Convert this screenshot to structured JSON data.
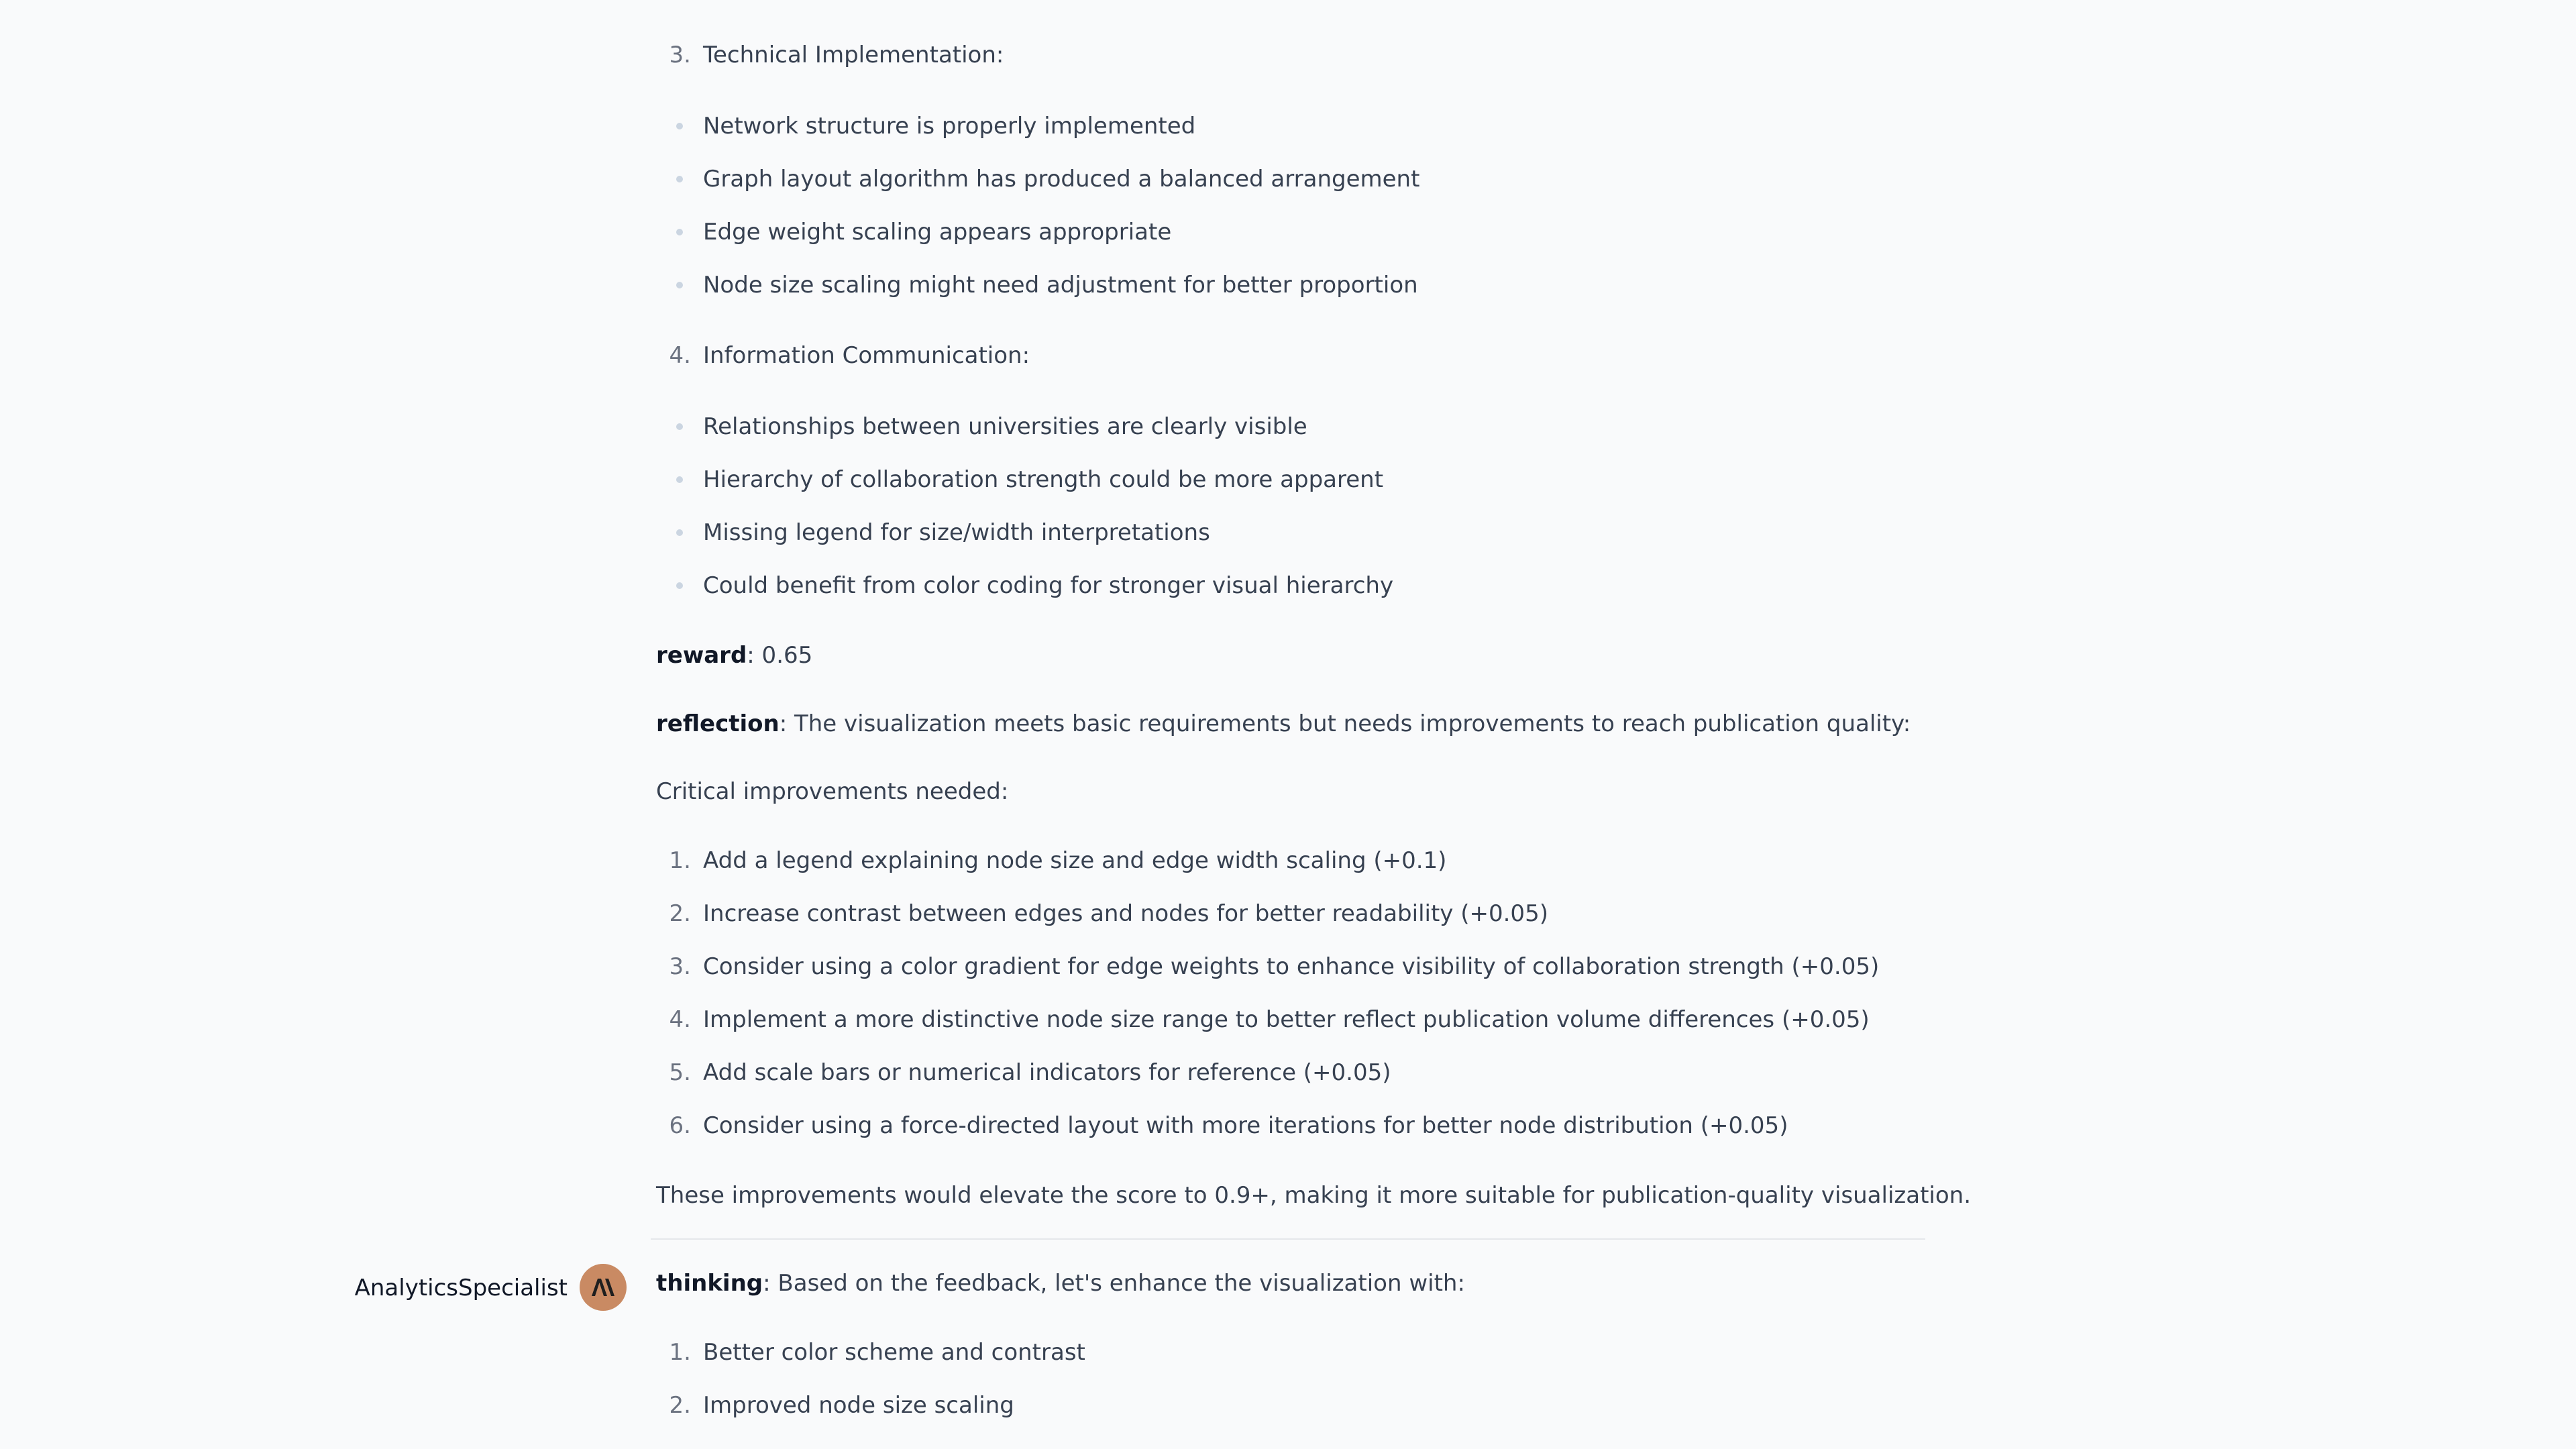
{
  "section3": {
    "num": "3.",
    "text": "Technical Implementation:"
  },
  "section3_bullets": [
    "Network structure is properly implemented",
    "Graph layout algorithm has produced a balanced arrangement",
    "Edge weight scaling appears appropriate",
    "Node size scaling might need adjustment for better proportion"
  ],
  "section4": {
    "num": "4.",
    "text": "Information Communication:"
  },
  "section4_bullets": [
    "Relationships between universities are clearly visible",
    "Hierarchy of collaboration strength could be more apparent",
    "Missing legend for size/width interpretations",
    "Could benefit from color coding for stronger visual hierarchy"
  ],
  "reward": {
    "label": "reward",
    "value": ": 0.65"
  },
  "reflection": {
    "label": "reflection",
    "text": ": The visualization meets basic requirements but needs improvements to reach publication quality:"
  },
  "critical_heading": "Critical improvements needed:",
  "improvements": [
    {
      "num": "1.",
      "text": "Add a legend explaining node size and edge width scaling (+0.1)"
    },
    {
      "num": "2.",
      "text": "Increase contrast between edges and nodes for better readability (+0.05)"
    },
    {
      "num": "3.",
      "text": "Consider using a color gradient for edge weights to enhance visibility of collaboration strength (+0.05)"
    },
    {
      "num": "4.",
      "text": "Implement a more distinctive node size range to better reflect publication volume differences (+0.05)"
    },
    {
      "num": "5.",
      "text": "Add scale bars or numerical indicators for reference (+0.05)"
    },
    {
      "num": "6.",
      "text": "Consider using a force-directed layout with more iterations for better node distribution (+0.05)"
    }
  ],
  "conclusion": "These improvements would elevate the score to 0.9+, making it more suitable for publication-quality visualization.",
  "next_message": {
    "author": "AnalyticsSpecialist",
    "avatar_glyph": "A\\",
    "thinking_label": "thinking",
    "thinking_text": ": Based on the feedback, let's enhance the visualization with:",
    "items": [
      {
        "num": "1.",
        "text": "Better color scheme and contrast"
      },
      {
        "num": "2.",
        "text": "Improved node size scaling"
      }
    ]
  },
  "colors": {
    "avatar_bg": "#c98a63",
    "text": "#374151",
    "bold": "#111827"
  }
}
